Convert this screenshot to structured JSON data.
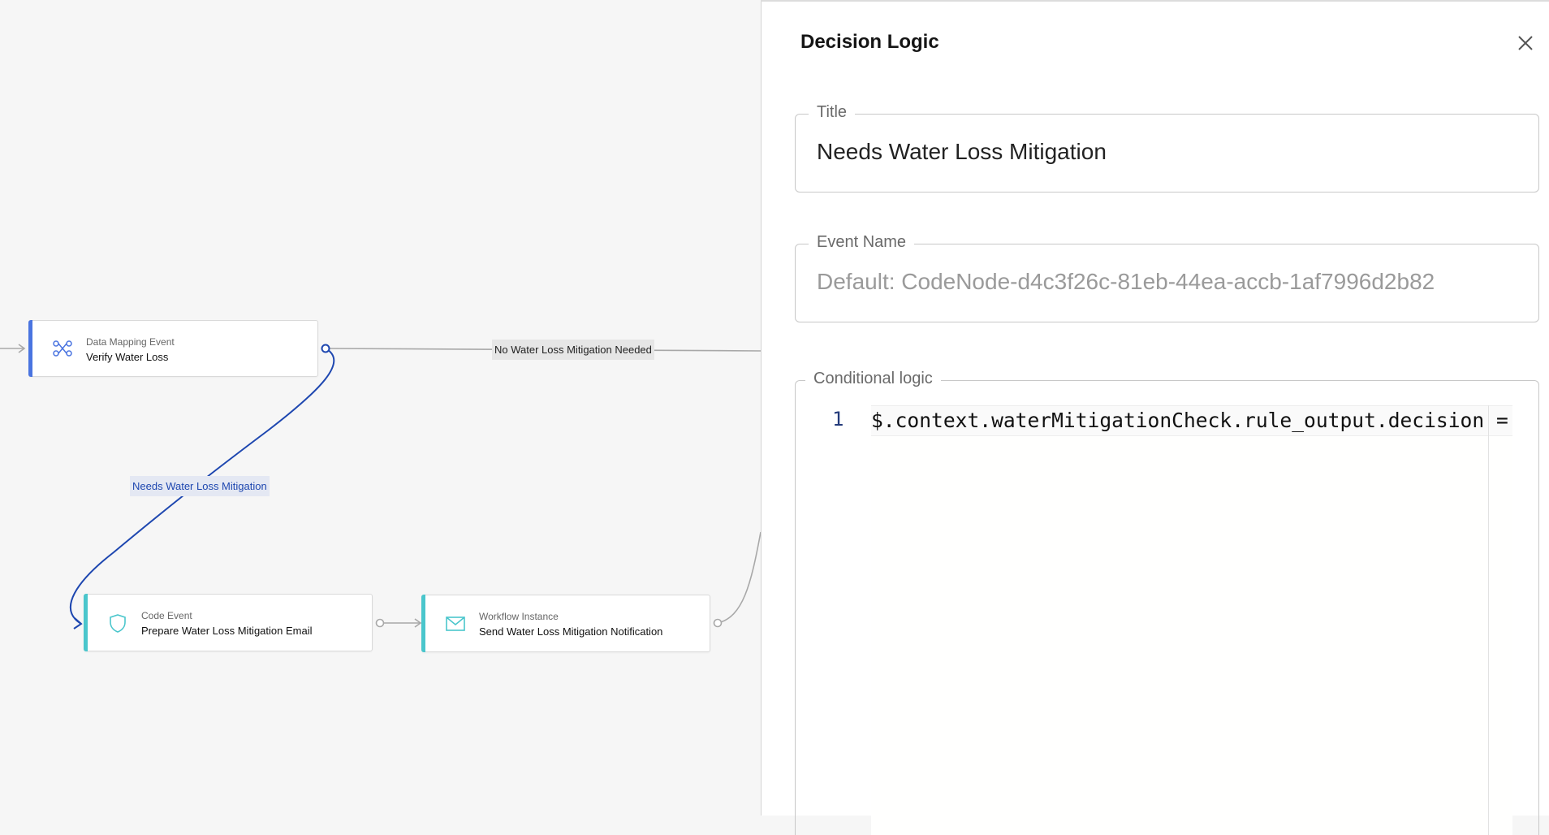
{
  "canvas": {
    "nodes": [
      {
        "type": "Data Mapping Event",
        "title": "Verify Water Loss",
        "icon": "data-mapping-icon",
        "accent": "#4a74e0"
      },
      {
        "type": "Code Event",
        "title": "Prepare Water Loss Mitigation Email",
        "icon": "shield-icon",
        "accent": "#4ac6cc"
      },
      {
        "type": "Workflow Instance",
        "title": "Send Water Loss Mitigation Notification",
        "icon": "envelope-icon",
        "accent": "#4ac6cc"
      }
    ],
    "edges": {
      "no_mitigation_label": "No Water Loss Mitigation Needed",
      "needs_mitigation_label": "Needs Water Loss Mitigation",
      "highlight_color": "#1e47b0"
    }
  },
  "panel": {
    "title": "Decision Logic",
    "close_icon": "close-icon",
    "title_field": {
      "label": "Title",
      "value": "Needs Water Loss Mitigation"
    },
    "event_field": {
      "label": "Event Name",
      "value": "",
      "placeholder": "Default: CodeNode-d4c3f26c-81eb-44ea-accb-1af7996d2b82"
    },
    "logic_field": {
      "label": "Conditional logic",
      "lines": [
        {
          "number": "1",
          "code": "$.context.waterMitigationCheck.rule_output.decision = '"
        }
      ]
    }
  }
}
